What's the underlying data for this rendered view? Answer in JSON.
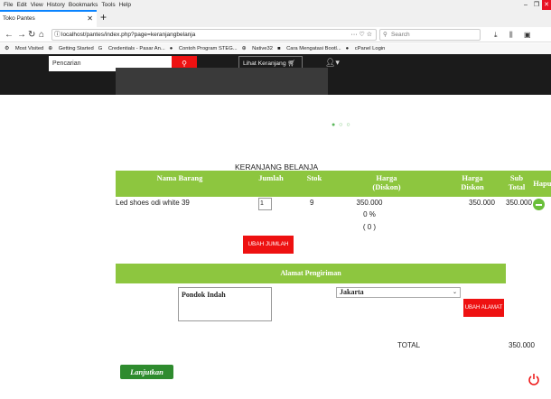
{
  "browser": {
    "menu": [
      "File",
      "Edit",
      "View",
      "History",
      "Bookmarks",
      "Tools",
      "Help"
    ],
    "window_controls": [
      "–",
      "❐",
      "✕"
    ],
    "tab_title": "Toko Pantes",
    "tab_close": "✕",
    "new_tab": "+",
    "url": "localhost/pantes/index.php?page=keranjangbelanja",
    "url_dots": "···",
    "search_placeholder": "Search",
    "bookmarks": [
      "Most Visited",
      "Getting Started",
      "Credentials - Pasar An...",
      "Contoh Program STEG...",
      "Native32",
      "Cara Mengatasi Bootl...",
      "cPanel Login"
    ]
  },
  "site": {
    "search_placeholder": "Pencarian",
    "cart_button": "Lihat Keranjang"
  },
  "cart": {
    "title": "KERANJANG BELANJA",
    "headers": {
      "nama": "Nama Barang",
      "jumlah": "Jumlah",
      "stok": "Stok",
      "harga_diskon": "Harga\n(Diskon)",
      "harga_diskon2": "Harga\nDiskon",
      "subtotal": "Sub\nTotal",
      "hapus": "Hapus"
    },
    "item": {
      "name": "Led shoes odi white 39",
      "qty": "1",
      "stock": "9",
      "price": "350.000",
      "discount_pct": "0 %",
      "discount_amt": "( 0 )",
      "discount_price": "350.000",
      "subtotal": "350.000"
    },
    "update_qty_label": "UBAH JUMLAH",
    "shipping_header": "Alamat Pengiriman",
    "address": "Pondok Indah",
    "city": "Jakarta",
    "update_address_label": "UBAH ALAMAT",
    "total_label": "TOTAL",
    "total_value": "350.000",
    "continue_label": "Lanjutkan"
  },
  "colors": {
    "green": "#8dc63f",
    "red": "#ee1111"
  }
}
